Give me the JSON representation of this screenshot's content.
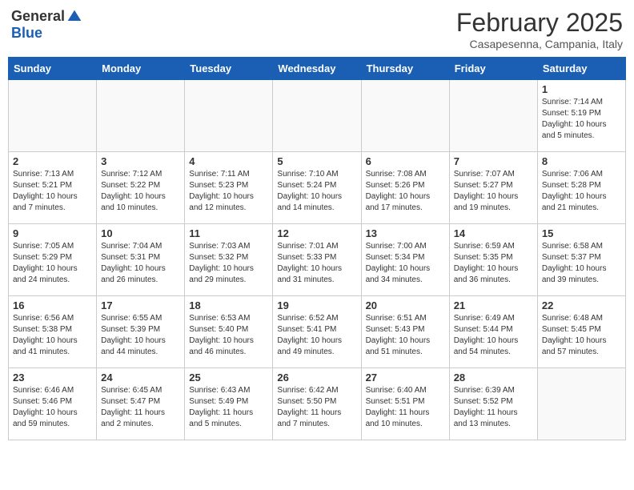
{
  "header": {
    "logo_general": "General",
    "logo_blue": "Blue",
    "month_title": "February 2025",
    "location": "Casapesenna, Campania, Italy"
  },
  "days_of_week": [
    "Sunday",
    "Monday",
    "Tuesday",
    "Wednesday",
    "Thursday",
    "Friday",
    "Saturday"
  ],
  "weeks": [
    [
      {
        "day": "",
        "info": ""
      },
      {
        "day": "",
        "info": ""
      },
      {
        "day": "",
        "info": ""
      },
      {
        "day": "",
        "info": ""
      },
      {
        "day": "",
        "info": ""
      },
      {
        "day": "",
        "info": ""
      },
      {
        "day": "1",
        "info": "Sunrise: 7:14 AM\nSunset: 5:19 PM\nDaylight: 10 hours\nand 5 minutes."
      }
    ],
    [
      {
        "day": "2",
        "info": "Sunrise: 7:13 AM\nSunset: 5:21 PM\nDaylight: 10 hours\nand 7 minutes."
      },
      {
        "day": "3",
        "info": "Sunrise: 7:12 AM\nSunset: 5:22 PM\nDaylight: 10 hours\nand 10 minutes."
      },
      {
        "day": "4",
        "info": "Sunrise: 7:11 AM\nSunset: 5:23 PM\nDaylight: 10 hours\nand 12 minutes."
      },
      {
        "day": "5",
        "info": "Sunrise: 7:10 AM\nSunset: 5:24 PM\nDaylight: 10 hours\nand 14 minutes."
      },
      {
        "day": "6",
        "info": "Sunrise: 7:08 AM\nSunset: 5:26 PM\nDaylight: 10 hours\nand 17 minutes."
      },
      {
        "day": "7",
        "info": "Sunrise: 7:07 AM\nSunset: 5:27 PM\nDaylight: 10 hours\nand 19 minutes."
      },
      {
        "day": "8",
        "info": "Sunrise: 7:06 AM\nSunset: 5:28 PM\nDaylight: 10 hours\nand 21 minutes."
      }
    ],
    [
      {
        "day": "9",
        "info": "Sunrise: 7:05 AM\nSunset: 5:29 PM\nDaylight: 10 hours\nand 24 minutes."
      },
      {
        "day": "10",
        "info": "Sunrise: 7:04 AM\nSunset: 5:31 PM\nDaylight: 10 hours\nand 26 minutes."
      },
      {
        "day": "11",
        "info": "Sunrise: 7:03 AM\nSunset: 5:32 PM\nDaylight: 10 hours\nand 29 minutes."
      },
      {
        "day": "12",
        "info": "Sunrise: 7:01 AM\nSunset: 5:33 PM\nDaylight: 10 hours\nand 31 minutes."
      },
      {
        "day": "13",
        "info": "Sunrise: 7:00 AM\nSunset: 5:34 PM\nDaylight: 10 hours\nand 34 minutes."
      },
      {
        "day": "14",
        "info": "Sunrise: 6:59 AM\nSunset: 5:35 PM\nDaylight: 10 hours\nand 36 minutes."
      },
      {
        "day": "15",
        "info": "Sunrise: 6:58 AM\nSunset: 5:37 PM\nDaylight: 10 hours\nand 39 minutes."
      }
    ],
    [
      {
        "day": "16",
        "info": "Sunrise: 6:56 AM\nSunset: 5:38 PM\nDaylight: 10 hours\nand 41 minutes."
      },
      {
        "day": "17",
        "info": "Sunrise: 6:55 AM\nSunset: 5:39 PM\nDaylight: 10 hours\nand 44 minutes."
      },
      {
        "day": "18",
        "info": "Sunrise: 6:53 AM\nSunset: 5:40 PM\nDaylight: 10 hours\nand 46 minutes."
      },
      {
        "day": "19",
        "info": "Sunrise: 6:52 AM\nSunset: 5:41 PM\nDaylight: 10 hours\nand 49 minutes."
      },
      {
        "day": "20",
        "info": "Sunrise: 6:51 AM\nSunset: 5:43 PM\nDaylight: 10 hours\nand 51 minutes."
      },
      {
        "day": "21",
        "info": "Sunrise: 6:49 AM\nSunset: 5:44 PM\nDaylight: 10 hours\nand 54 minutes."
      },
      {
        "day": "22",
        "info": "Sunrise: 6:48 AM\nSunset: 5:45 PM\nDaylight: 10 hours\nand 57 minutes."
      }
    ],
    [
      {
        "day": "23",
        "info": "Sunrise: 6:46 AM\nSunset: 5:46 PM\nDaylight: 10 hours\nand 59 minutes."
      },
      {
        "day": "24",
        "info": "Sunrise: 6:45 AM\nSunset: 5:47 PM\nDaylight: 11 hours\nand 2 minutes."
      },
      {
        "day": "25",
        "info": "Sunrise: 6:43 AM\nSunset: 5:49 PM\nDaylight: 11 hours\nand 5 minutes."
      },
      {
        "day": "26",
        "info": "Sunrise: 6:42 AM\nSunset: 5:50 PM\nDaylight: 11 hours\nand 7 minutes."
      },
      {
        "day": "27",
        "info": "Sunrise: 6:40 AM\nSunset: 5:51 PM\nDaylight: 11 hours\nand 10 minutes."
      },
      {
        "day": "28",
        "info": "Sunrise: 6:39 AM\nSunset: 5:52 PM\nDaylight: 11 hours\nand 13 minutes."
      },
      {
        "day": "",
        "info": ""
      }
    ]
  ]
}
